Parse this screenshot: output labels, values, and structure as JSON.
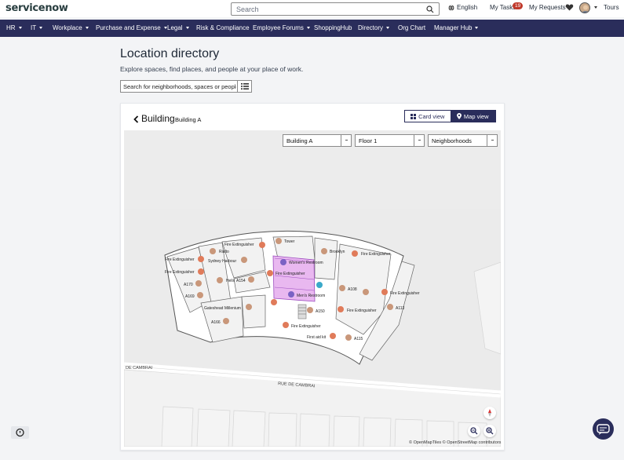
{
  "header": {
    "logo_text": "servicenow",
    "search_placeholder": "Search",
    "language": "English",
    "tasks_label": "My Tasks",
    "tasks_count": "19",
    "requests_label": "My Requests",
    "tours_label": "Tours"
  },
  "nav": {
    "items": [
      {
        "label": "HR"
      },
      {
        "label": "IT"
      },
      {
        "label": "Workplace"
      },
      {
        "label": "Purchase and Expense"
      },
      {
        "label": "Legal"
      },
      {
        "label": "Risk & Compliance"
      },
      {
        "label": "Employee Forums"
      },
      {
        "label": "ShoppingHub"
      },
      {
        "label": "Directory"
      },
      {
        "label": "Org Chart"
      },
      {
        "label": "Manager Hub"
      }
    ]
  },
  "page": {
    "title": "Location directory",
    "subtitle": "Explore spaces, find places, and people at your place of work.",
    "search_placeholder": "Search for neighborhoods, spaces or people"
  },
  "building": {
    "heading": "Building",
    "name": "Building A",
    "card_view": "Card view",
    "map_view": "Map view"
  },
  "filters": {
    "building": "Building A",
    "floor": "Floor 1",
    "layer": "Neighborhoods"
  },
  "map": {
    "labels": {
      "fire_ext_1": "Fire Extinguisher",
      "tower": "Tower",
      "rialto": "Rialto",
      "brooklyn": "Brooklyn",
      "fire_ext_2": "Fire Extinguisher",
      "fire_ext_3": "Fire Extinguisher",
      "sydney": "Sydney Harbour",
      "womens": "Women's Restroom",
      "fire_ext_4": "Fire Extinguisher",
      "fire_ext_5": "Fire Extinguisher",
      "helix": "Helix",
      "a154": "A154",
      "a170": "A170",
      "a108": "A108",
      "mens": "Men's Restroom",
      "fire_ext_6": "Fire Extinguisher",
      "a169": "A169",
      "a113": "A113",
      "gateshead": "Gateshead Millenium",
      "a150": "A150",
      "fire_ext_7": "Fire Extinguisher",
      "a166": "A166",
      "fire_ext_8": "Fire Extinguisher",
      "first_aid": "First aid kit",
      "a115": "A115",
      "street_1": "DE CAMBRAI",
      "street_2": "RUE DE CAMBRAI"
    },
    "attribution": "© OpenMapTiles © OpenStreetMap contributors"
  },
  "colors": {
    "nav_bg": "#2a2d5b",
    "pin": "#e07b5a",
    "pin_room": "#c9977a",
    "highlight": "#e9b8f0"
  }
}
